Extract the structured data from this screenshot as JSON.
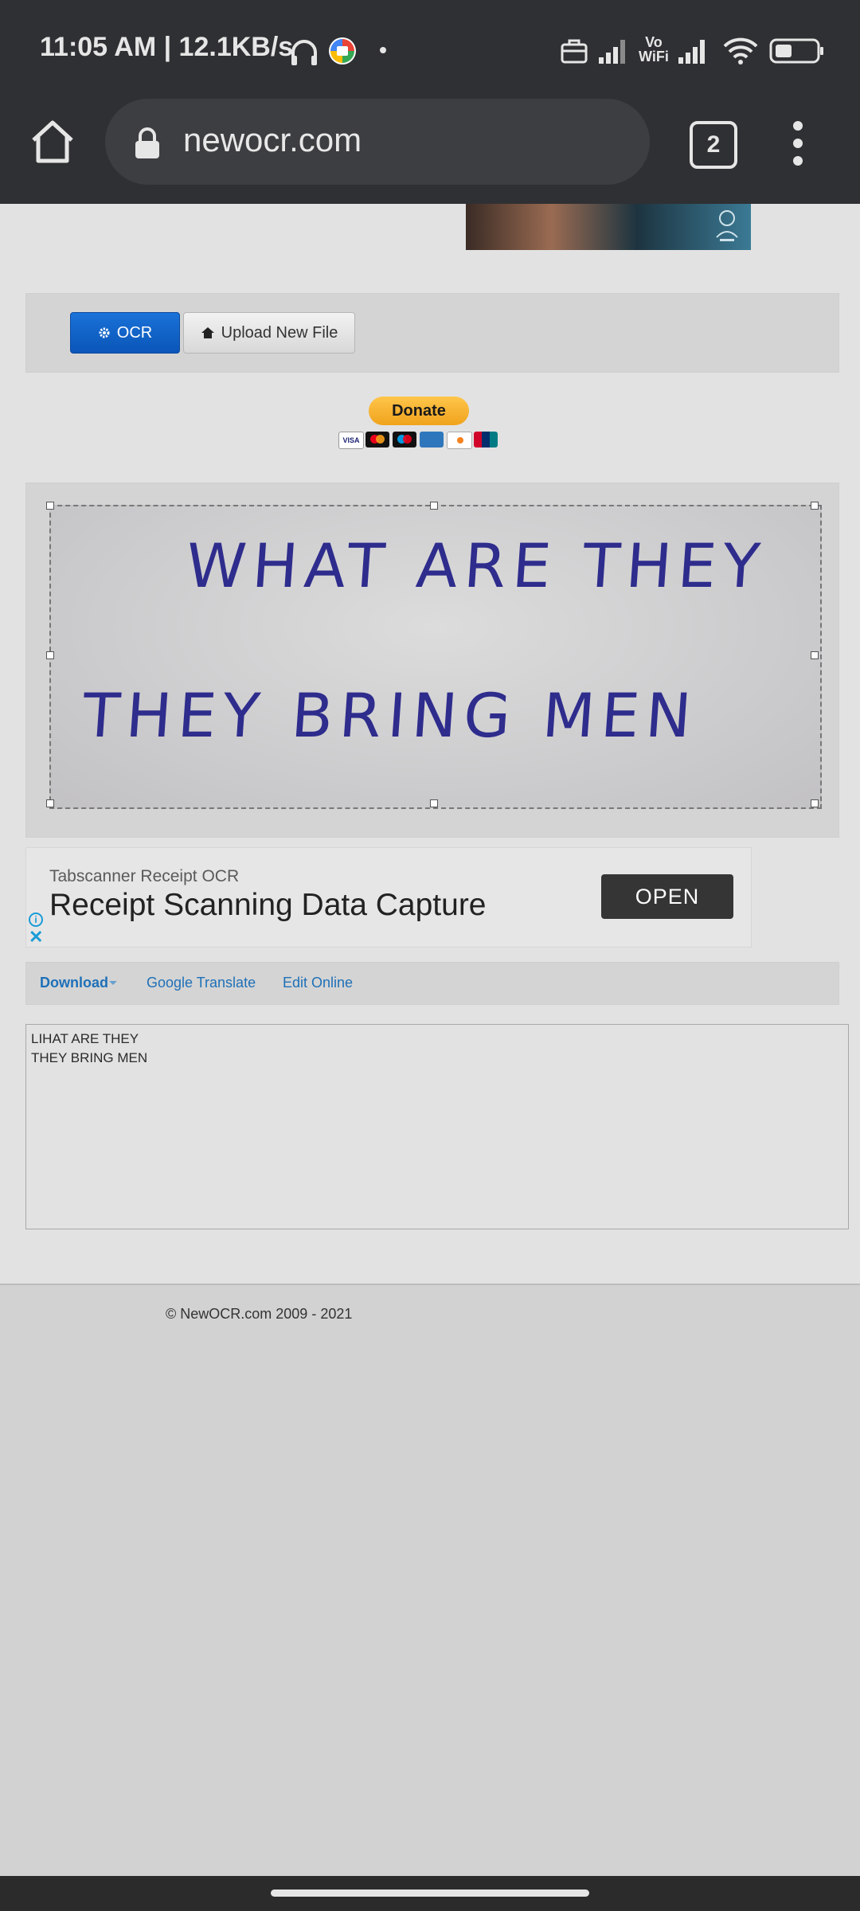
{
  "status_bar": {
    "time": "11:05 AM | 12.1KB/s",
    "icons": [
      "headphones-icon",
      "duo-app-icon",
      "dot-icon",
      "briefcase-icon",
      "signal-icon",
      "vowifi-icon",
      "signal-icon",
      "wifi-icon",
      "battery-icon"
    ],
    "vowifi_label_top": "Vo",
    "vowifi_label_bottom": "WiFi"
  },
  "browser": {
    "url": "newocr.com",
    "tab_count": "2"
  },
  "toolbar": {
    "ocr_label": "OCR",
    "upload_label": "Upload New File"
  },
  "donate": {
    "label": "Donate",
    "cards": [
      "visa",
      "mastercard",
      "maestro",
      "amex",
      "discover",
      "unionpay"
    ]
  },
  "image": {
    "line1": "WHAT ARE THEY",
    "line2": "THEY BRING MEN"
  },
  "ad": {
    "subtitle": "Tabscanner Receipt OCR",
    "title": "Receipt Scanning Data Capture",
    "cta": "OPEN",
    "info_glyph": "i",
    "close_glyph": "✕"
  },
  "actions": {
    "download": "Download",
    "translate": "Google Translate",
    "edit": "Edit Online"
  },
  "result": {
    "lines": [
      "LIHAT ARE THEY",
      "THEY BRING MEN"
    ]
  },
  "footer": {
    "copyright": "© NewOCR.com 2009 - 2021"
  },
  "colors": {
    "primary_button": "#0a55b8",
    "link": "#1e70b8",
    "handwriting": "#2e2c8c",
    "chrome": "#2f3033"
  }
}
